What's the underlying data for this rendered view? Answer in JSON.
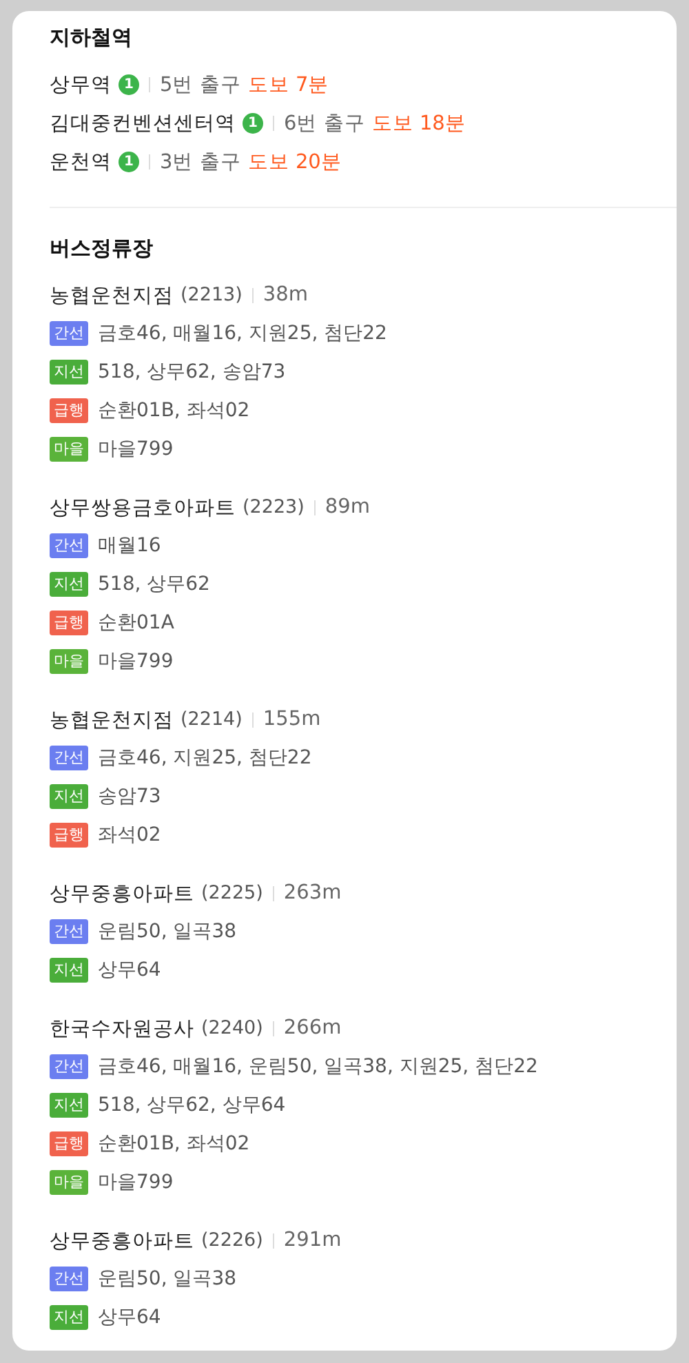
{
  "subway": {
    "title": "지하철역",
    "stations": [
      {
        "name": "상무역",
        "line": "1",
        "color": "#3cb44a",
        "exit": "5번 출구",
        "walk": "도보 7분"
      },
      {
        "name": "김대중컨벤션센터역",
        "line": "1",
        "color": "#3cb44a",
        "exit": "6번 출구",
        "walk": "도보 18분"
      },
      {
        "name": "운천역",
        "line": "1",
        "color": "#3cb44a",
        "exit": "3번 출구",
        "walk": "도보 20분"
      }
    ]
  },
  "bus": {
    "title": "버스정류장",
    "stops": [
      {
        "name": "농협운천지점",
        "code": "(2213)",
        "distance": "38m",
        "routes": [
          {
            "type": "간선",
            "color": "#6b7ef0",
            "buses": "금호46, 매월16, 지원25, 첨단22"
          },
          {
            "type": "지선",
            "color": "#4aad3a",
            "buses": "518, 상무62, 송암73"
          },
          {
            "type": "급행",
            "color": "#f0624d",
            "buses": "순환01B, 좌석02"
          },
          {
            "type": "마을",
            "color": "#5ab33a",
            "buses": "마을799"
          }
        ]
      },
      {
        "name": "상무쌍용금호아파트",
        "code": "(2223)",
        "distance": "89m",
        "routes": [
          {
            "type": "간선",
            "color": "#6b7ef0",
            "buses": "매월16"
          },
          {
            "type": "지선",
            "color": "#4aad3a",
            "buses": "518, 상무62"
          },
          {
            "type": "급행",
            "color": "#f0624d",
            "buses": "순환01A"
          },
          {
            "type": "마을",
            "color": "#5ab33a",
            "buses": "마을799"
          }
        ]
      },
      {
        "name": "농협운천지점",
        "code": "(2214)",
        "distance": "155m",
        "routes": [
          {
            "type": "간선",
            "color": "#6b7ef0",
            "buses": "금호46, 지원25, 첨단22"
          },
          {
            "type": "지선",
            "color": "#4aad3a",
            "buses": "송암73"
          },
          {
            "type": "급행",
            "color": "#f0624d",
            "buses": "좌석02"
          }
        ]
      },
      {
        "name": "상무중흥아파트",
        "code": "(2225)",
        "distance": "263m",
        "routes": [
          {
            "type": "간선",
            "color": "#6b7ef0",
            "buses": "운림50, 일곡38"
          },
          {
            "type": "지선",
            "color": "#4aad3a",
            "buses": "상무64"
          }
        ]
      },
      {
        "name": "한국수자원공사",
        "code": "(2240)",
        "distance": "266m",
        "routes": [
          {
            "type": "간선",
            "color": "#6b7ef0",
            "buses": "금호46, 매월16, 운림50, 일곡38, 지원25, 첨단22"
          },
          {
            "type": "지선",
            "color": "#4aad3a",
            "buses": "518, 상무62, 상무64"
          },
          {
            "type": "급행",
            "color": "#f0624d",
            "buses": "순환01B, 좌석02"
          },
          {
            "type": "마을",
            "color": "#5ab33a",
            "buses": "마을799"
          }
        ]
      },
      {
        "name": "상무중흥아파트",
        "code": "(2226)",
        "distance": "291m",
        "routes": [
          {
            "type": "간선",
            "color": "#6b7ef0",
            "buses": "운림50, 일곡38"
          },
          {
            "type": "지선",
            "color": "#4aad3a",
            "buses": "상무64"
          }
        ]
      }
    ]
  }
}
